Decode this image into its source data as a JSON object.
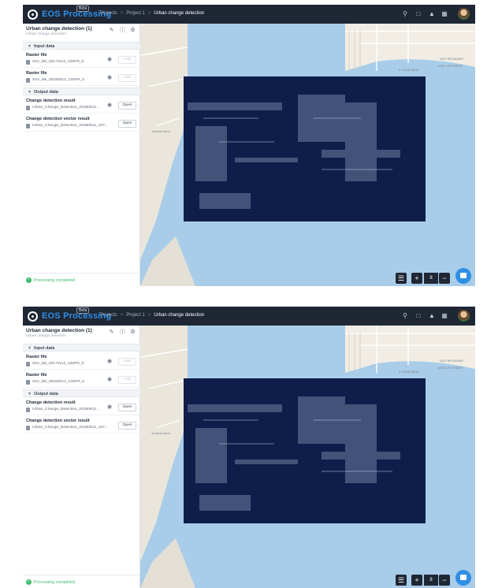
{
  "app": {
    "brand": "EOS Processing",
    "badge": "Beta",
    "breadcrumb": [
      "Projects",
      "Project 1",
      "Urban change detection"
    ]
  },
  "panel": {
    "title": "Urban change detection (1)",
    "subtitle": "Urban change detection",
    "input_section": "Input data",
    "output_section": "Output data",
    "inputs": [
      {
        "label": "Raster file",
        "file": "S2A_tile_20171113_13SFR_0",
        "button": "Add"
      },
      {
        "label": "Raster file",
        "file": "S2A_tile_20180212_13SFR_0",
        "button": "Add"
      }
    ],
    "outputs": [
      {
        "label": "Change detection result",
        "file": "Urban_Change_Detection_20180612...",
        "button": "Open"
      },
      {
        "label": "Change detection vector result",
        "file": "Urban_Change_Detection_20180612_107...",
        "button": "Open"
      }
    ],
    "status": "Processing completed"
  },
  "map": {
    "zoom": "8",
    "labels": [
      "Terminal Island",
      "EAST BROADWAY",
      "EAST 1ST STREET",
      "E OCEAN BLVD"
    ],
    "colors": {
      "water": "#a9cde9",
      "land": "#f1ede4",
      "imagery": "#0f1d4a",
      "accent": "#2f8fe5",
      "status": "#3dbb6a"
    }
  },
  "icons": [
    "logo-icon",
    "search-icon",
    "fullscreen-icon",
    "bell-icon",
    "apps-grid-icon",
    "edit-icon",
    "info-icon",
    "settings-icon",
    "eye-icon",
    "file-icon",
    "chevron-down-icon",
    "check-circle-icon",
    "layers-icon",
    "zoom-in-icon",
    "zoom-out-icon",
    "chat-icon"
  ]
}
